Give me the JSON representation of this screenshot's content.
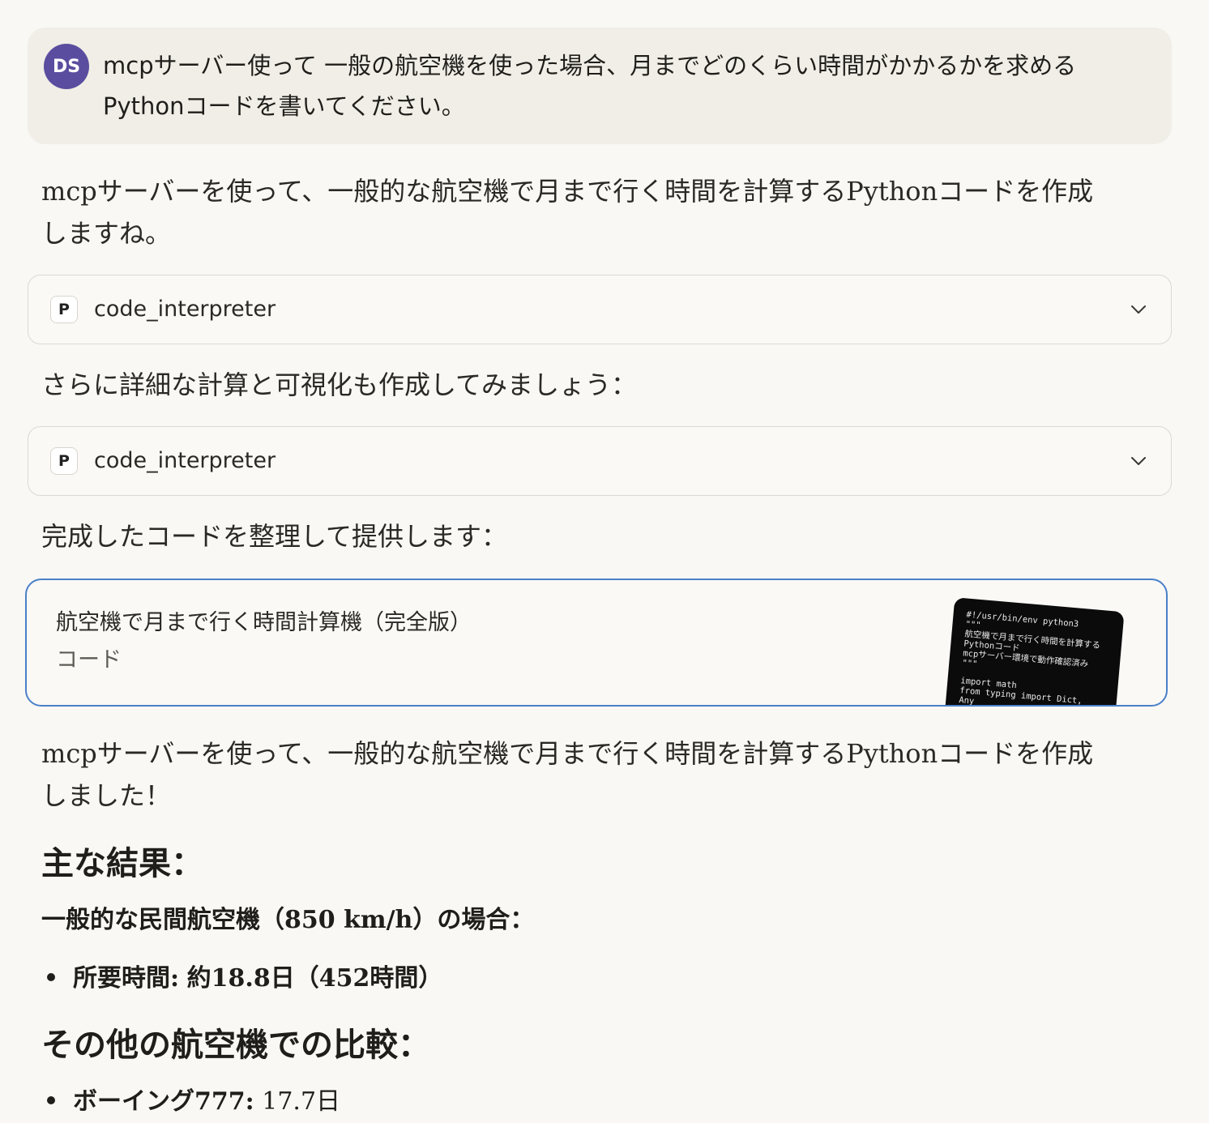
{
  "user_message": {
    "avatar_initials": "DS",
    "text": "mcpサーバー使って 一般の航空機を使った場合、月までどのくらい時間がかかるかを求めるPythonコードを書いてください。"
  },
  "assistant": {
    "intro": "mcpサーバーを使って、一般的な航空機で月まで行く時間を計算するPythonコードを作成しますね。",
    "tool_calls": [
      {
        "badge": "P",
        "name": "code_interpreter"
      },
      {
        "badge": "P",
        "name": "code_interpreter"
      }
    ],
    "after_tool_1": "さらに詳細な計算と可視化も作成してみましょう：",
    "after_tool_2": "完成したコードを整理して提供します：",
    "artifact": {
      "title": "航空機で月まで行く時間計算機（完全版）",
      "type": "コード",
      "preview_lines": [
        "#!/usr/bin/env python3",
        "\"\"\"",
        "航空機で月まで行く時間を計算する",
        "Pythonコード",
        "mcpサーバー環境で動作確認済み",
        "\"\"\"",
        "",
        "import math",
        "from typing import Dict,",
        "Any"
      ]
    },
    "summary": "mcpサーバーを使って、一般的な航空機で月まで行く時間を計算するPythonコードを作成しました！",
    "main_results_heading": "主な結果：",
    "case_heading": "一般的な民間航空機（850 km/h）の場合：",
    "case_bullets": [
      {
        "label": "所要時間:",
        "value": "約18.8日（452時間）"
      }
    ],
    "comparison_heading": "その他の航空機での比較：",
    "comparison_bullets": [
      {
        "label": "ボーイング777:",
        "value": "17.7日"
      }
    ]
  }
}
